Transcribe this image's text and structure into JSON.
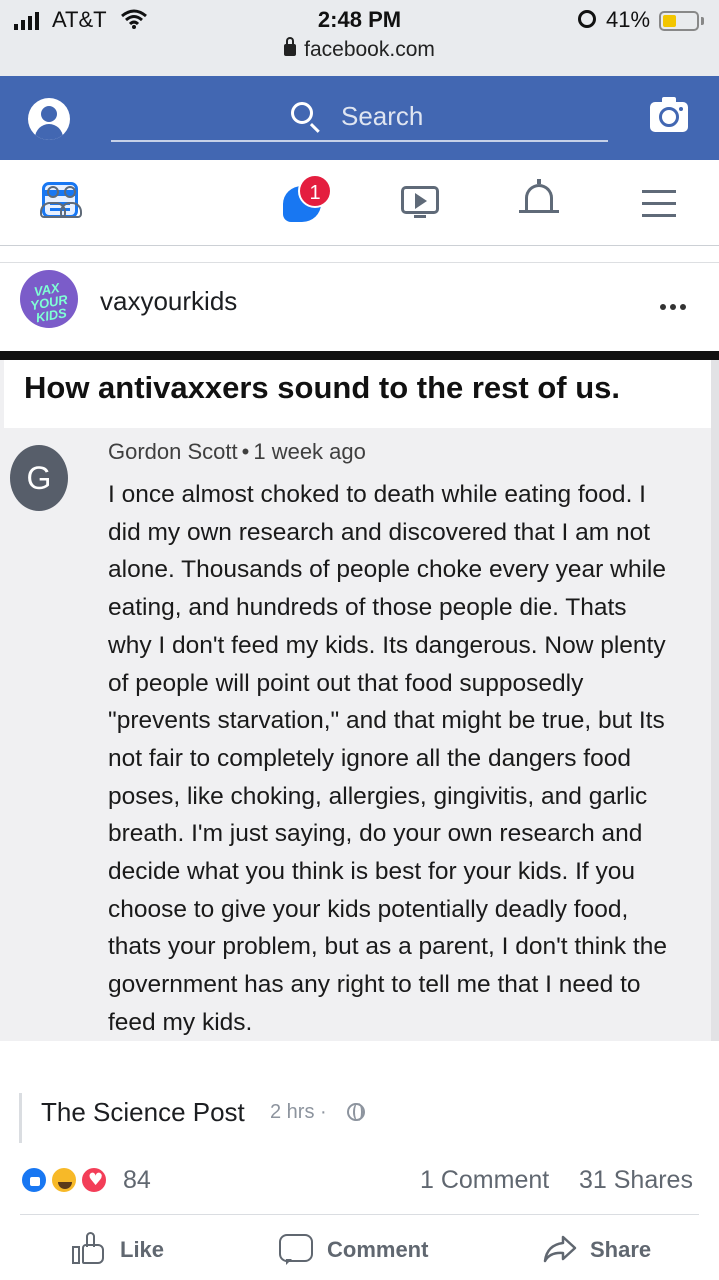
{
  "status_bar": {
    "carrier": "AT&T",
    "time": "2:48 PM",
    "battery": "41%",
    "battery_level": 0.41,
    "url": "facebook.com"
  },
  "header": {
    "search_placeholder": "Search",
    "brand_color": "#4267b2"
  },
  "nav": {
    "tabs": [
      {
        "icon": "news-feed-icon",
        "active": true
      },
      {
        "icon": "friends-icon"
      },
      {
        "icon": "messenger-icon",
        "badge": "1"
      },
      {
        "icon": "watch-icon"
      },
      {
        "icon": "notifications-bell-icon"
      },
      {
        "icon": "menu-icon"
      }
    ]
  },
  "post": {
    "page_name": "vaxyourkids",
    "avatar_logo_text": "VAX YOUR KIDS",
    "meme": {
      "title": "How antivaxxers sound to the rest of us.",
      "commenter_initial": "G",
      "commenter_name": "Gordon Scott",
      "comment_time": "1 week ago",
      "comment_lines": [
        "I once almost choked to death while eating food.  I",
        "did my own research and discovered that I am not",
        "alone.  Thousands of people choke every year while",
        "eating, and hundreds of those people die.  Thats",
        "why I don't feed my kids.  Its dangerous.  Now plenty",
        "of people will point out that food supposedly",
        "\"prevents starvation,\" and that might be true, but Its",
        "not fair to completely ignore all the dangers food",
        "poses, like choking, allergies, gingivitis, and garlic",
        "breath.  I'm just saying, do your own research and",
        "decide what you think is best for your kids. If you",
        "choose to give your kids potentially deadly food,",
        "thats your problem, but as a parent, I don't think the",
        "government has any right to tell me that I need to",
        "feed my kids."
      ]
    },
    "source_name": "The Science Post",
    "source_time": "2 hrs ·",
    "reactions_count": "84",
    "comments": "1 Comment",
    "shares": "31 Shares",
    "actions": {
      "like": "Like",
      "comment": "Comment",
      "share": "Share"
    }
  }
}
